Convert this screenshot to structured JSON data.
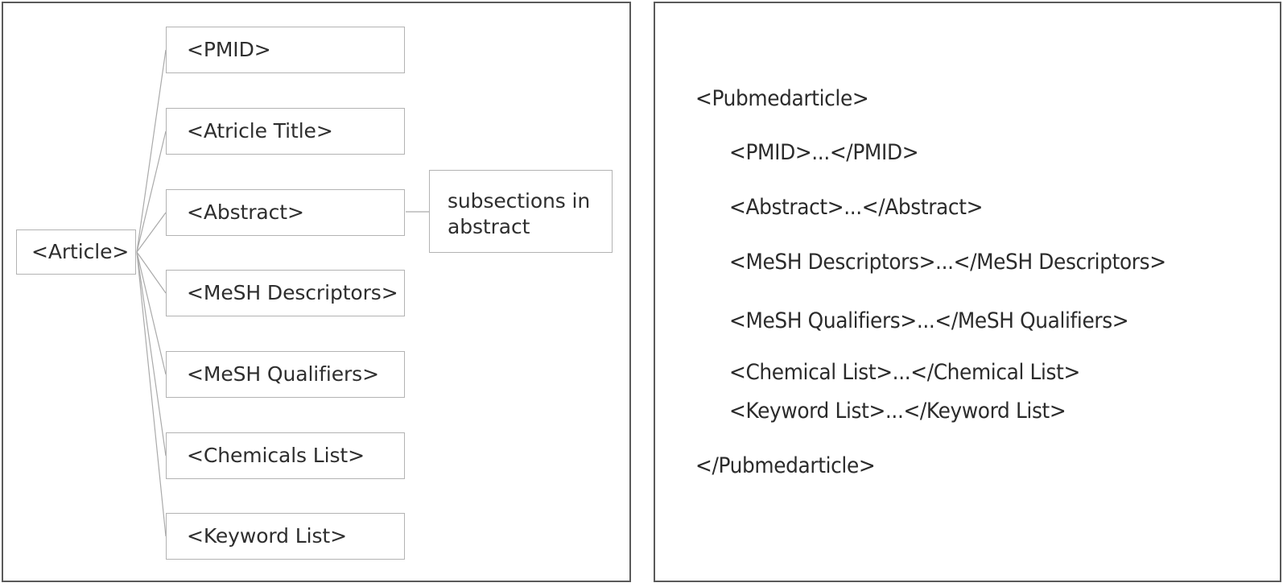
{
  "figure": {
    "type": "two-panel-diagram",
    "panels": [
      "tree-diagram",
      "xml-structure"
    ]
  },
  "tree": {
    "root": {
      "label": "<Article>"
    },
    "children": [
      {
        "label": "<PMID>"
      },
      {
        "label": "<Atricle Title>"
      },
      {
        "label": "<Abstract>"
      },
      {
        "label": "<MeSH Descriptors>"
      },
      {
        "label": "<MeSH Qualifiers>"
      },
      {
        "label": "<Chemicals List>"
      },
      {
        "label": "<Keyword List>"
      }
    ],
    "annotation": {
      "label": "subsections in abstract"
    }
  },
  "xml": {
    "lines": [
      {
        "indent": 0,
        "text": "<Pubmedarticle>"
      },
      {
        "indent": 1,
        "text": "<PMID>...</PMID>"
      },
      {
        "indent": 1,
        "text": "<Abstract>...</Abstract>"
      },
      {
        "indent": 1,
        "text": "<MeSH Descriptors>...</MeSH Descriptors>"
      },
      {
        "indent": 1,
        "text": "<MeSH Qualifiers>...</MeSH Qualifiers>"
      },
      {
        "indent": 1,
        "text": "<Chemical List>...</Chemical List>"
      },
      {
        "indent": 1,
        "text": "<Keyword List>...</Keyword List>"
      },
      {
        "indent": 0,
        "text": "</Pubmedarticle>"
      }
    ]
  },
  "colors": {
    "panel_border": "#5a5a5a",
    "node_border": "#b3b3b3",
    "connector": "#aaaaaa",
    "text": "#2e2e2e",
    "background": "#ffffff"
  }
}
